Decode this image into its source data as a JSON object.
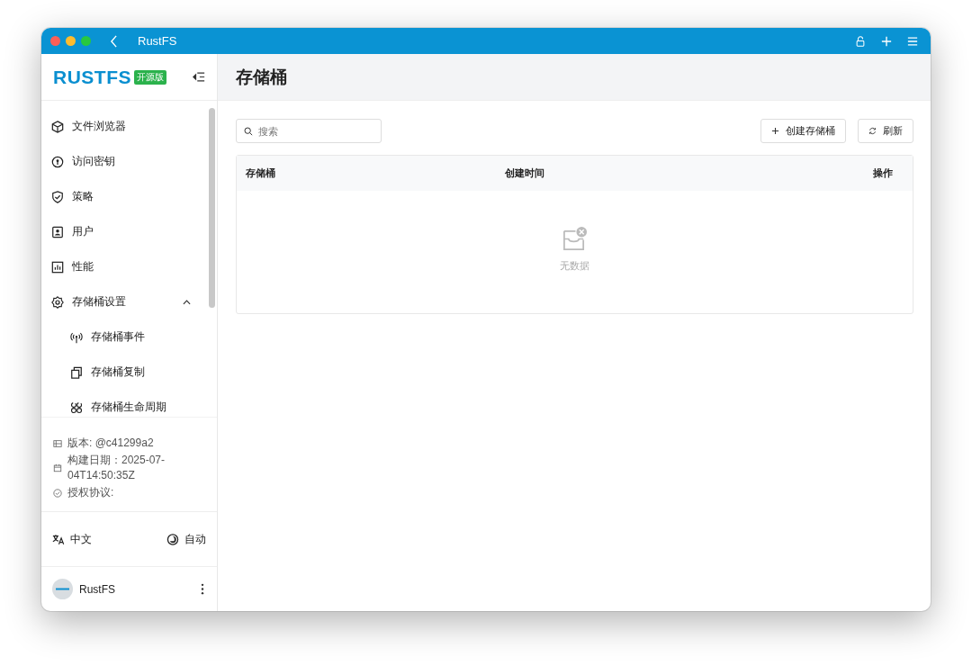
{
  "window": {
    "title": "RustFS"
  },
  "sidebar": {
    "logo": "RUSTFS",
    "edition_badge": "开源版",
    "nav": [
      {
        "label": "文件浏览器",
        "selected": false
      },
      {
        "label": "访问密钥",
        "selected": false
      },
      {
        "label": "策略",
        "selected": false
      },
      {
        "label": "用户",
        "selected": false
      },
      {
        "label": "性能",
        "selected": false
      },
      {
        "label": "存储桶设置",
        "selected": false,
        "expanded": true,
        "children": [
          {
            "label": "存储桶事件",
            "selected": false
          },
          {
            "label": "存储桶复制",
            "selected": false
          },
          {
            "label": "存储桶生命周期",
            "selected": false
          }
        ]
      }
    ],
    "info": [
      "版本: @c41299a2",
      "构建日期：2025-07-04T14:50:35Z",
      "授权协议:"
    ],
    "language": "中文",
    "theme": "自动",
    "user": {
      "name": "RustFS"
    }
  },
  "page": {
    "title": "存储桶",
    "search": {
      "placeholder": "搜索"
    },
    "buttons": [
      "创建存储桶",
      "刷新"
    ],
    "table": {
      "columns": [
        "存储桶",
        "创建时间",
        "操作"
      ],
      "empty_text": "无数据"
    }
  }
}
